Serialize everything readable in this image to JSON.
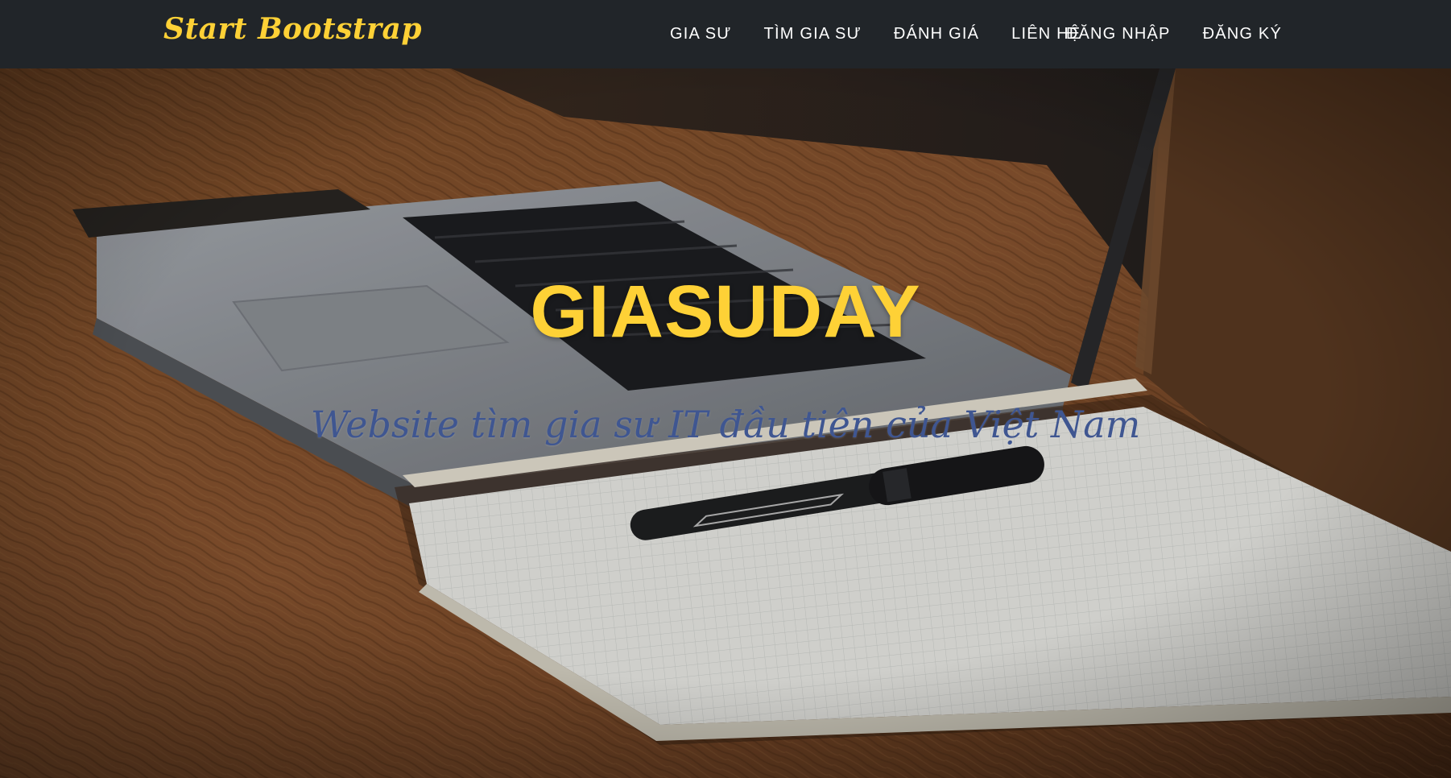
{
  "navbar": {
    "brand": "Start Bootstrap",
    "links_left": [
      "GIA SƯ",
      "TÌM GIA SƯ",
      "ĐÁNH GIÁ",
      "LIÊN HỆ"
    ],
    "links_right": [
      "ĐĂNG NHẬP",
      "ĐĂNG KÝ"
    ]
  },
  "hero": {
    "heading": "GIASUDAY",
    "subheading": "Website tìm gia sư IT đầu tiên của Việt Nam"
  },
  "colors": {
    "navbar_bg": "#212529",
    "accent": "#fed136",
    "subheading": "#3f5691"
  }
}
